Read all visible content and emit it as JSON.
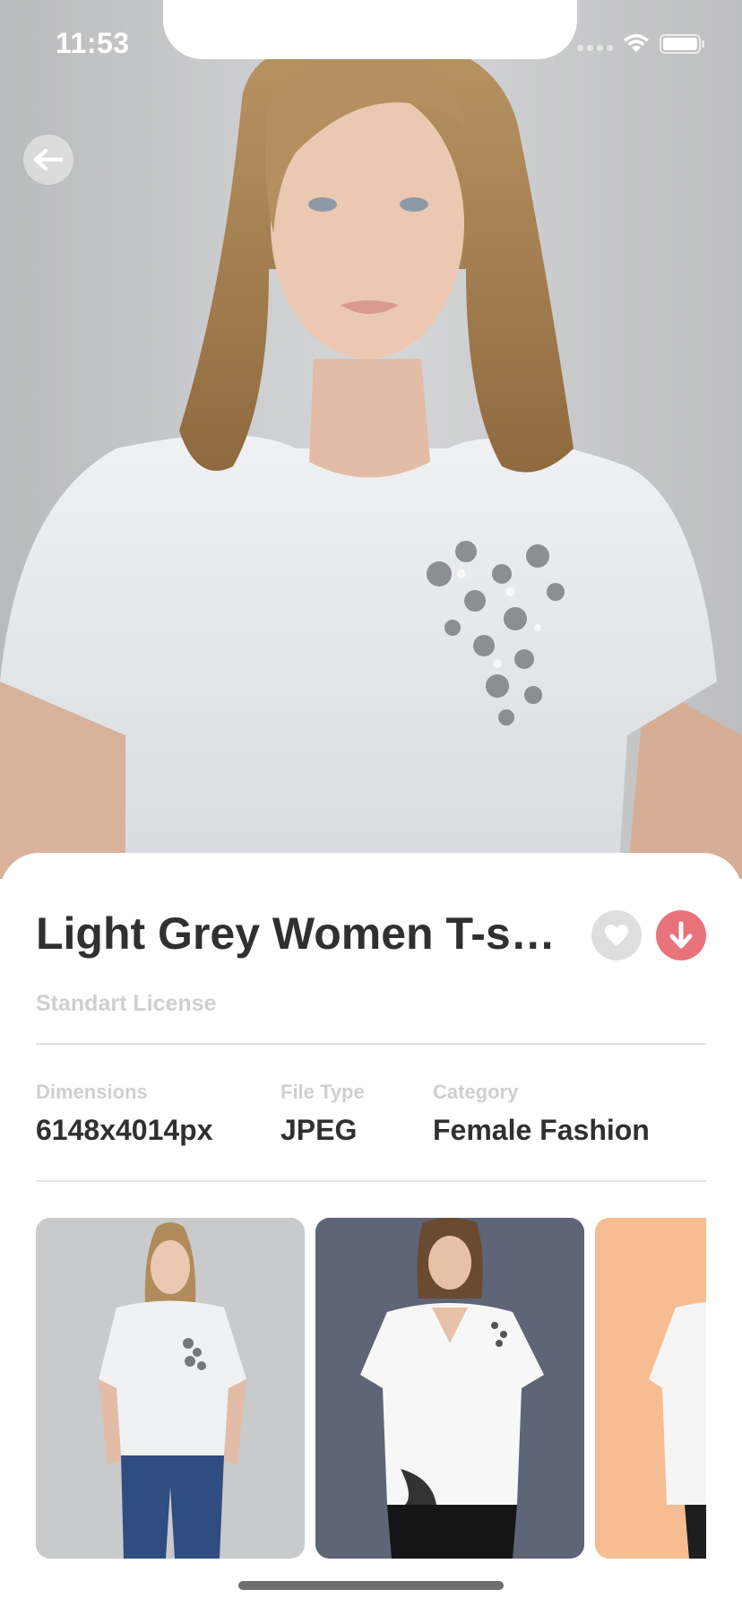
{
  "status_bar": {
    "time": "11:53"
  },
  "hero": {
    "back_icon": "arrow-left-icon"
  },
  "product": {
    "title": "Light Grey Women T-shirt",
    "license": "Standart License",
    "favorite_icon": "heart-icon",
    "download_icon": "arrow-down-icon"
  },
  "details": [
    {
      "label": "Dimensions",
      "value": "6148x4014px"
    },
    {
      "label": "File Type",
      "value": "JPEG"
    },
    {
      "label": "Category",
      "value": "Female Fashion"
    }
  ],
  "colors": {
    "accent": "#e8737b",
    "title": "#303030",
    "muted": "#cfcfcf",
    "thumb1_bg": "#c9cacb",
    "thumb2_bg": "#5d6577",
    "thumb3_bg": "#f6bd92"
  }
}
